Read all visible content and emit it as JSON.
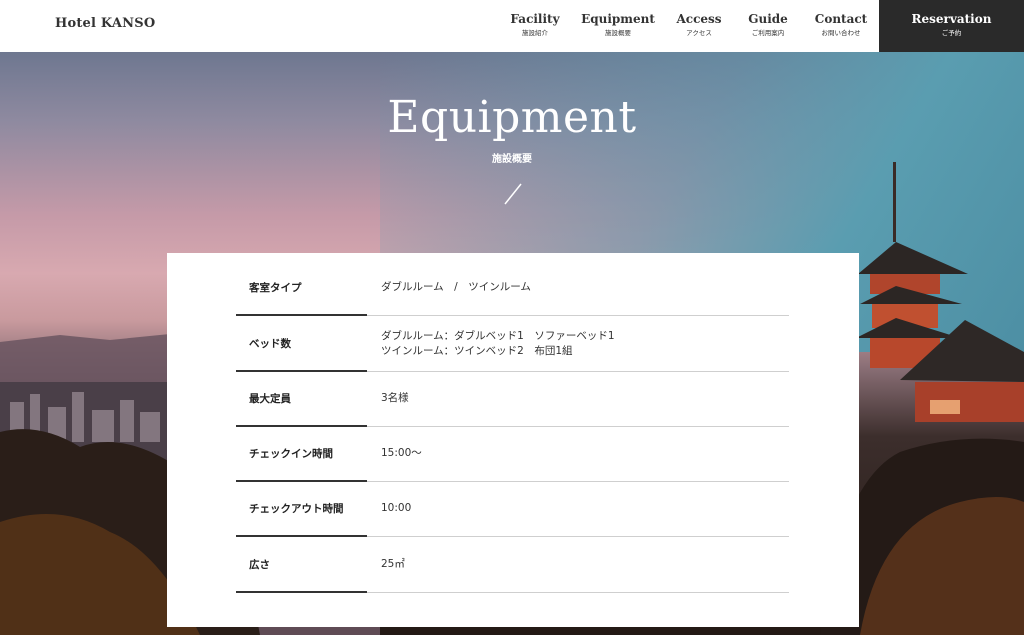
{
  "header": {
    "brand": "Hotel KANSO",
    "nav": [
      {
        "en": "Facility",
        "ja": "施設紹介"
      },
      {
        "en": "Equipment",
        "ja": "施設概要"
      },
      {
        "en": "Access",
        "ja": "アクセス"
      },
      {
        "en": "Guide",
        "ja": "ご利用案内"
      },
      {
        "en": "Contact",
        "ja": "お問い合わせ"
      }
    ],
    "reservation": {
      "en": "Reservation",
      "ja": "ご予約"
    }
  },
  "hero": {
    "title": "Equipment",
    "subtitle": "施設概要",
    "divider_icon": "slash-icon"
  },
  "table": {
    "rows": [
      {
        "label": "客室タイプ",
        "values": [
          "ダブルルーム　/　ツインルーム"
        ]
      },
      {
        "label": "ベッド数",
        "values": [
          "ダブルルーム：ダブルベッド1　ソファーベッド1",
          "ツインルーム：ツインベッド2　布団1組"
        ]
      },
      {
        "label": "最大定員",
        "values": [
          "3名様"
        ]
      },
      {
        "label": "チェックイン時間",
        "values": [
          "15:00〜"
        ]
      },
      {
        "label": "チェックアウト時間",
        "values": [
          "10:00"
        ]
      },
      {
        "label": "広さ",
        "values": [
          "25㎡"
        ]
      }
    ]
  },
  "colors": {
    "header_bg": "#ffffff",
    "reservation_bg": "#2a2a2a",
    "text": "#222222",
    "card_bg": "#ffffff",
    "row_divider": "#cfcfcf",
    "label_underline": "#333333"
  }
}
